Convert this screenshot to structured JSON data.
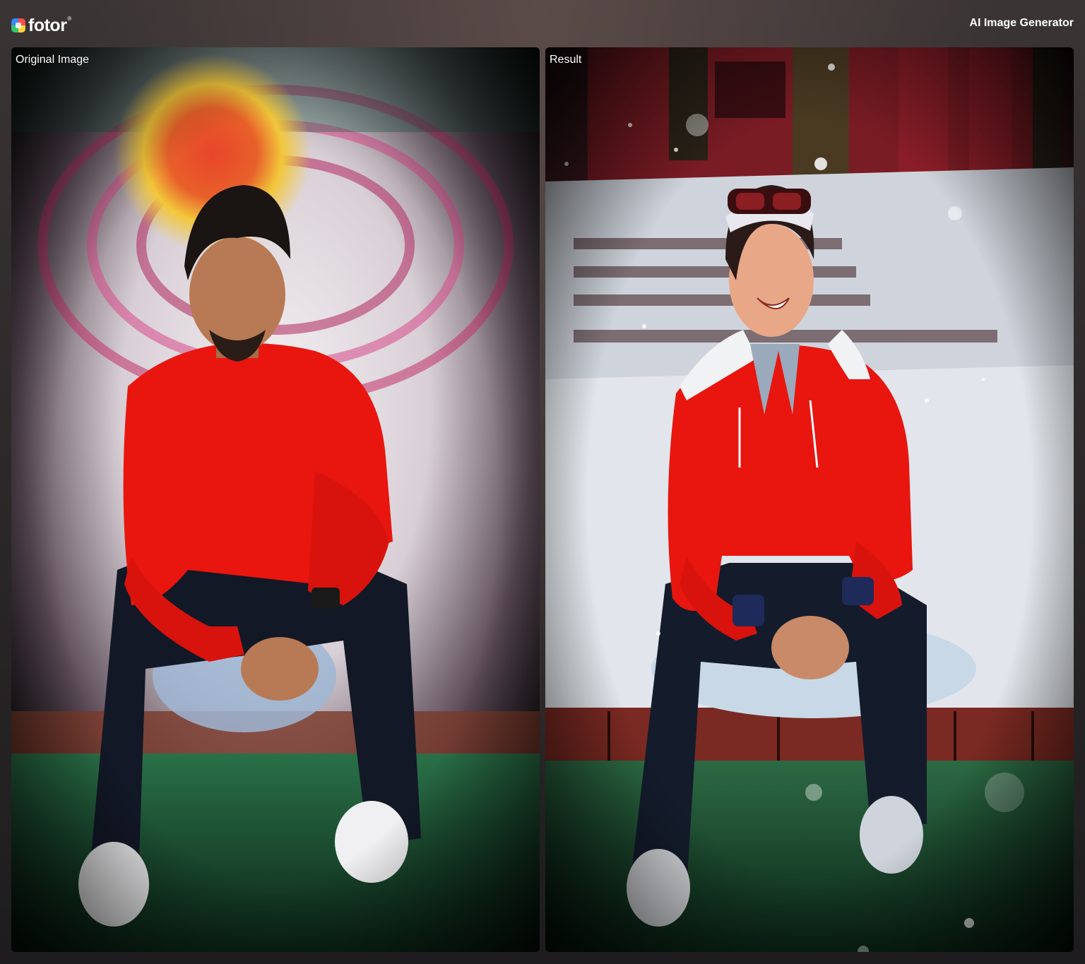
{
  "header": {
    "brand": "fotor",
    "brand_reg": "®",
    "title": "AI Image Generator"
  },
  "panels": {
    "left": {
      "label": "Original Image"
    },
    "right": {
      "label": "Result"
    }
  },
  "colors": {
    "shirt_red": "#e8160f",
    "jeans": "#121826",
    "floor_green": "#1a5a34",
    "snow": "#dde3ea",
    "skin": "#b87a55"
  }
}
